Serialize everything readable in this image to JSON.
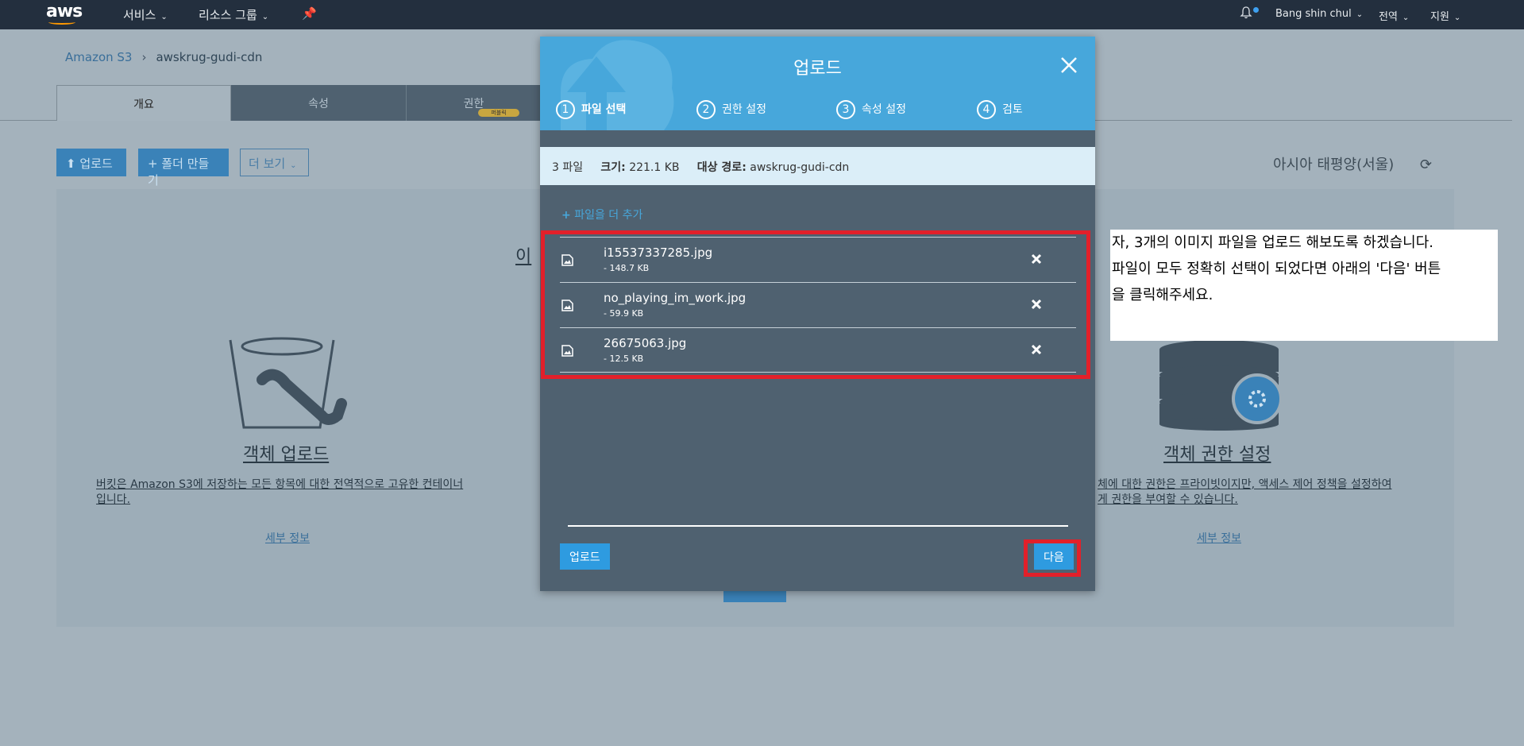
{
  "topnav": {
    "logo": "aws",
    "services": "서비스",
    "resource_groups": "리소스 그룹",
    "user": "Bang shin chul",
    "region": "전역",
    "support": "지원"
  },
  "breadcrumb": {
    "root": "Amazon S3",
    "sep": "›",
    "bucket": "awskrug-gudi-cdn"
  },
  "tabs": [
    {
      "label": "개요"
    },
    {
      "label": "속성"
    },
    {
      "label": "권한",
      "badge": "퍼블릭"
    }
  ],
  "actions": {
    "upload": "업로드",
    "create_folder": "폴더 만들기",
    "more": "더 보기"
  },
  "region_label": "아시아 태평양(서울)",
  "features": {
    "left": {
      "title": "객체 업로드",
      "desc_line1": "버킷은 Amazon S3에 저장하는 모든 항목에 대한 전역적으로 고유한 컨테이너",
      "desc_line2": "입니다.",
      "link": "세부 정보"
    },
    "middle_partial": "이",
    "right": {
      "title": "객체 권한 설정",
      "desc_line1": "체에 대한 권한은 프라이빗이지만, 액세스 제어 정책을 설정하여",
      "desc_line2": "게 권한을 부여할 수 있습니다.",
      "link": "세부 정보"
    }
  },
  "modal": {
    "title": "업로드",
    "steps": [
      {
        "num": "1",
        "label": "파일 선택"
      },
      {
        "num": "2",
        "label": "권한 설정"
      },
      {
        "num": "3",
        "label": "속성 설정"
      },
      {
        "num": "4",
        "label": "검토"
      }
    ],
    "summary": {
      "count": "3 파일",
      "size_label": "크기:",
      "size_value": "221.1 KB",
      "dest_label": "대상 경로:",
      "dest_value": "awskrug-gudi-cdn"
    },
    "add_more": "파일을 더 추가",
    "files": [
      {
        "name": "i15537337285.jpg",
        "size": "- 148.7 KB"
      },
      {
        "name": "no_playing_im_work.jpg",
        "size": "- 59.9 KB"
      },
      {
        "name": "26675063.jpg",
        "size": "- 12.5 KB"
      }
    ],
    "upload_button": "업로드",
    "next_button": "다음"
  },
  "callout": {
    "line1": "자, 3개의 이미지 파일을 업로드 해보도록 하겠습니다.",
    "line2": "파일이 모두 정확히 선택이 되었다면 아래의 '다음' 버튼",
    "line3": "을 클릭해주세요."
  },
  "colors": {
    "nav": "#232f3e",
    "modal_header": "#47a7db",
    "modal_body": "#4f6170",
    "highlight": "#e2202a",
    "button": "#2e9be0"
  }
}
